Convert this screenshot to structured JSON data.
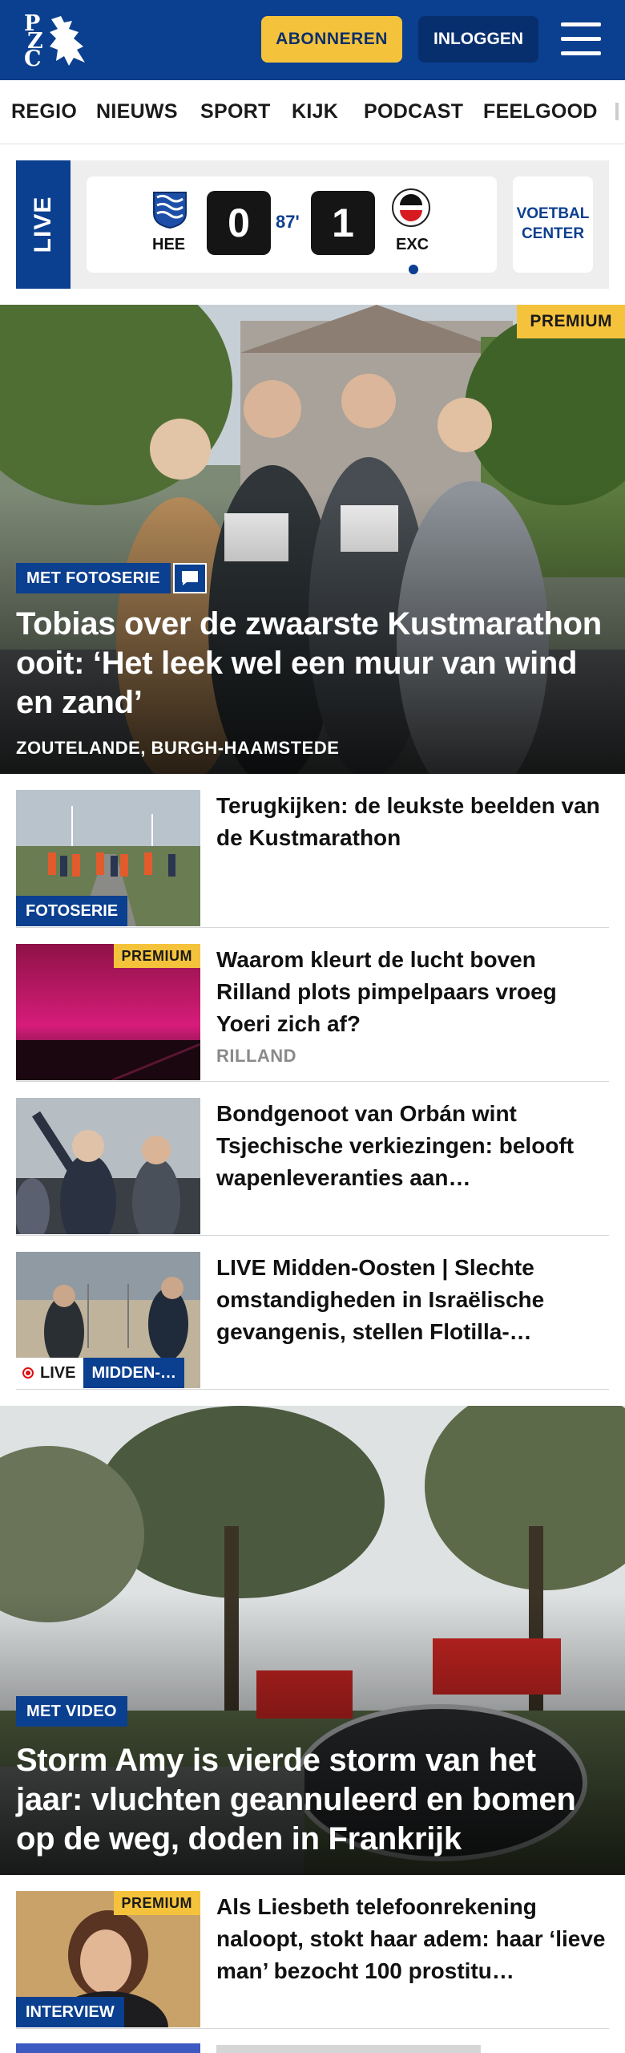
{
  "header": {
    "logo_letters": [
      "P",
      "Z",
      "C"
    ],
    "subscribe_label": "ABONNEREN",
    "login_label": "INLOGGEN"
  },
  "nav": {
    "items": [
      "REGIO",
      "NIEUWS",
      "SPORT",
      "KIJK",
      "PODCAST",
      "FEELGOOD"
    ]
  },
  "live_match": {
    "live_label": "LIVE",
    "home_team": "HEE",
    "home_score": "0",
    "minute": "87'",
    "away_score": "1",
    "away_team": "EXC",
    "center_label": "VOETBAL CENTER"
  },
  "hero1": {
    "premium_label": "PREMIUM",
    "tag": "MET FOTOSERIE",
    "title": "Tobias over de zwaarste Kustmara­thon ooit: ‘Het leek wel een muur van wind en zand’",
    "location": "ZOUTELANDE, BURGH-HAAMSTEDE"
  },
  "list1": [
    {
      "title": "Terugkijken: de leukste beelden van de Kustmarathon",
      "thumb_label": "FOTOSERIE"
    },
    {
      "title": "Waarom kleurt de lucht boven Rilland plots pimpelpaars vroeg Yoeri zich af?",
      "location": "RILLAND",
      "premium_label": "PREMIUM"
    },
    {
      "title": "Bondgenoot van Orbán wint Tsjechische verkiezingen: belooft wapenleveranties aan…"
    },
    {
      "title": "LIVE Midden-Oosten | Slechte omstandigheden in Israëlische gevangenis, stellen Flotilla-…",
      "live_label": "LIVE",
      "topic_label": "MIDDEN-…"
    }
  ],
  "hero2": {
    "tag": "MET VIDEO",
    "title": "Storm Amy is vierde storm van het jaar: vluchten geannuleerd en bomen op de weg, doden in Frankrijk"
  },
  "list2": [
    {
      "title": "Als Liesbeth telefoonrekening naloopt, stokt haar adem: haar ‘lieve man’ bezocht 100 prostitu…",
      "premium_label": "PREMIUM",
      "thumb_label": "INTERVIEW"
    }
  ],
  "colors": {
    "brand_blue": "#0b3f8f",
    "premium_yellow": "#f5c33b"
  }
}
